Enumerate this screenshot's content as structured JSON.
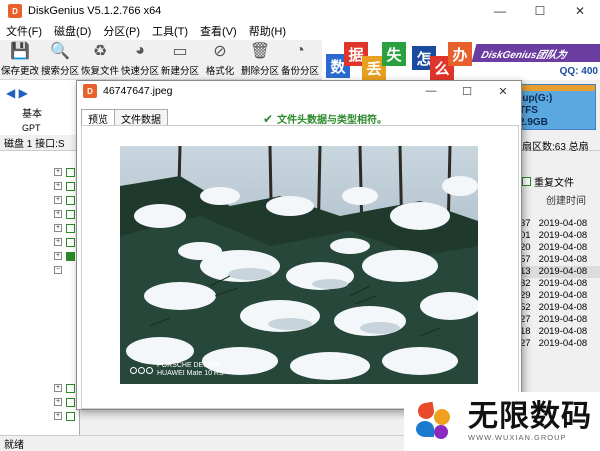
{
  "app": {
    "title": "DiskGenius V5.1.2.766 x64",
    "icon_label": "D",
    "window_controls": {
      "minimize": "—",
      "maximize": "☐",
      "close": "✕"
    }
  },
  "menu": [
    "文件(F)",
    "磁盘(D)",
    "分区(P)",
    "工具(T)",
    "查看(V)",
    "帮助(H)"
  ],
  "toolbar": [
    {
      "label": "保存更改",
      "icon": "save-icon",
      "glyph": "💾"
    },
    {
      "label": "搜索分区",
      "icon": "search-icon",
      "glyph": "🔍"
    },
    {
      "label": "恢复文件",
      "icon": "recover-icon",
      "glyph": "♻"
    },
    {
      "label": "快速分区",
      "icon": "quick-partition-icon",
      "glyph": "◕"
    },
    {
      "label": "新建分区",
      "icon": "new-partition-icon",
      "glyph": "▭"
    },
    {
      "label": "格式化",
      "icon": "format-icon",
      "glyph": "⊘"
    },
    {
      "label": "删除分区",
      "icon": "trash-icon",
      "glyph": "🗑"
    },
    {
      "label": "备份分区",
      "icon": "backup-icon",
      "glyph": "◔"
    }
  ],
  "banner": {
    "chars": [
      {
        "c": "数",
        "color": "#2a6ad0"
      },
      {
        "c": "据",
        "color": "#e0352a"
      },
      {
        "c": "丢",
        "color": "#e8a020"
      },
      {
        "c": "失",
        "color": "#2aa040"
      },
      {
        "c": "怎",
        "color": "#1a4ba0"
      },
      {
        "c": "么",
        "color": "#e0352a"
      },
      {
        "c": "办",
        "color": "#e8602c"
      }
    ],
    "team": "DiskGenius团队为",
    "qq": "QQ: 400"
  },
  "left": {
    "basic": "基本",
    "gpt": "GPT",
    "disk_line": "磁盘 1 接口:S"
  },
  "right": {
    "tile_lines": [
      "tup(G:)",
      "TFS",
      "2.9GB"
    ],
    "info": "扇区数:63  总扇",
    "dup_label": "重复文件",
    "col_header": "创建时间",
    "rows": [
      {
        "t": "37",
        "d": "2019-04-08"
      },
      {
        "t": "01",
        "d": "2019-04-08"
      },
      {
        "t": "20",
        "d": "2019-04-08"
      },
      {
        "t": "57",
        "d": "2019-04-08"
      },
      {
        "t": "13",
        "d": "2019-04-08",
        "selected": true
      },
      {
        "t": "32",
        "d": "2019-04-08"
      },
      {
        "t": "29",
        "d": "2019-04-08"
      },
      {
        "t": "52",
        "d": "2019-04-08"
      },
      {
        "t": "27",
        "d": "2019-04-08"
      },
      {
        "t": "18",
        "d": "2019-04-08"
      },
      {
        "t": "27",
        "d": "2019-04-08"
      }
    ]
  },
  "status": "就绪",
  "dialog": {
    "title": "46747647.jpeg",
    "tabs": [
      "预览",
      "文件数据"
    ],
    "match_text": "文件头数据与类型相符。"
  },
  "photo": {
    "watermark_brand": "PORSCHE DESIGN",
    "watermark_model": "HUAWEI Mate 10 RS"
  },
  "brand": {
    "name": "无限数码",
    "url": "WWW.WUXIAN.GROUP"
  }
}
